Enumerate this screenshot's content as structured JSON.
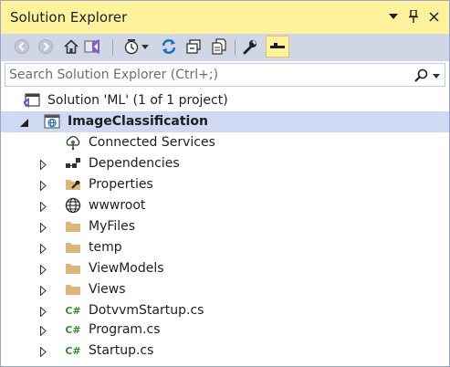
{
  "window": {
    "title": "Solution Explorer",
    "accent": "#fff29d",
    "toolbar_bg": "#cfd6e5",
    "selected_bg": "#cfd9f3"
  },
  "title_controls": [
    {
      "name": "dropdown-icon",
      "glyph": "▾"
    },
    {
      "name": "pin-icon",
      "glyph": "⊥"
    },
    {
      "name": "close-icon",
      "glyph": "✕"
    }
  ],
  "toolbar": {
    "buttons": [
      "back-icon",
      "forward-icon",
      "home-icon",
      "switch-views-icon",
      "pending-changes-filter-icon",
      "sync-icon",
      "collapse-all-icon",
      "show-all-files-icon",
      "properties-icon",
      "preview-selected-items-icon"
    ],
    "active_button": "preview-selected-items-icon"
  },
  "search": {
    "placeholder": "Search Solution Explorer (Ctrl+;)",
    "value": ""
  },
  "tree": {
    "solution": {
      "label": "Solution 'ML' (1 of 1 project)",
      "icon": "solution-icon"
    },
    "project": {
      "label": "ImageClassification",
      "icon": "web-project-icon",
      "expanded": true,
      "selected": true
    },
    "items": [
      {
        "label": "Connected Services",
        "icon": "connected-services-icon",
        "expandable": false
      },
      {
        "label": "Dependencies",
        "icon": "dependencies-icon",
        "expandable": true
      },
      {
        "label": "Properties",
        "icon": "properties-folder-icon",
        "expandable": true
      },
      {
        "label": "wwwroot",
        "icon": "globe-icon",
        "expandable": true
      },
      {
        "label": "MyFiles",
        "icon": "folder-icon",
        "expandable": true
      },
      {
        "label": "temp",
        "icon": "folder-icon",
        "expandable": true
      },
      {
        "label": "ViewModels",
        "icon": "folder-icon",
        "expandable": true
      },
      {
        "label": "Views",
        "icon": "folder-icon",
        "expandable": true
      },
      {
        "label": "DotvvmStartup.cs",
        "icon": "csharp-file-icon",
        "expandable": true
      },
      {
        "label": "Program.cs",
        "icon": "csharp-file-icon",
        "expandable": true
      },
      {
        "label": "Startup.cs",
        "icon": "csharp-file-icon",
        "expandable": true
      }
    ]
  }
}
